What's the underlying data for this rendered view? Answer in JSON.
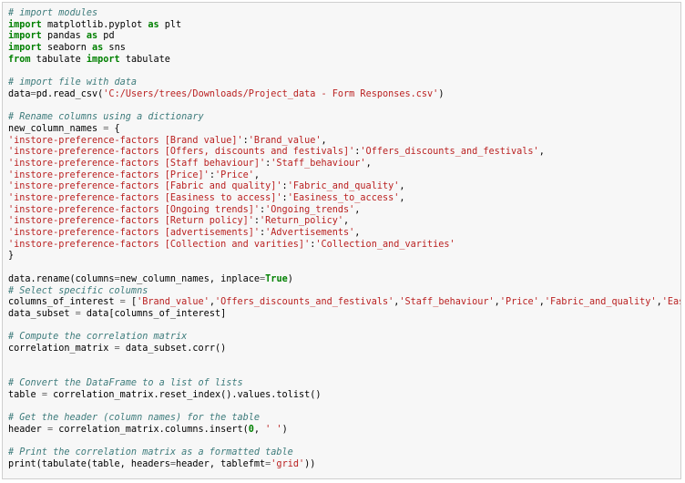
{
  "editor": {
    "lines": [
      [
        [
          "cm",
          "# import modules"
        ]
      ],
      [
        [
          "kw",
          "import"
        ],
        [
          "nm",
          " matplotlib.pyplot "
        ],
        [
          "kw",
          "as"
        ],
        [
          "nm",
          " plt"
        ]
      ],
      [
        [
          "kw",
          "import"
        ],
        [
          "nm",
          " pandas "
        ],
        [
          "kw",
          "as"
        ],
        [
          "nm",
          " pd"
        ]
      ],
      [
        [
          "kw",
          "import"
        ],
        [
          "nm",
          " seaborn "
        ],
        [
          "kw",
          "as"
        ],
        [
          "nm",
          " sns"
        ]
      ],
      [
        [
          "kw",
          "from"
        ],
        [
          "nm",
          " tabulate "
        ],
        [
          "kw",
          "import"
        ],
        [
          "nm",
          " tabulate"
        ]
      ],
      [],
      [
        [
          "cm",
          "# import file with data"
        ]
      ],
      [
        [
          "nm",
          "data"
        ],
        [
          "op",
          "="
        ],
        [
          "nm",
          "pd.read_csv("
        ],
        [
          "st",
          "'C:/Users/trees/Downloads/Project_data - Form Responses.csv'"
        ],
        [
          "nm",
          ")"
        ]
      ],
      [],
      [
        [
          "cm",
          "# Rename columns using a dictionary"
        ]
      ],
      [
        [
          "nm",
          "new_column_names "
        ],
        [
          "op",
          "="
        ],
        [
          "nm",
          " {"
        ]
      ],
      [
        [
          "st",
          "'instore-preference-factors [Brand value]'"
        ],
        [
          "nm",
          ":"
        ],
        [
          "st",
          "'Brand_value'"
        ],
        [
          "nm",
          ","
        ]
      ],
      [
        [
          "st",
          "'instore-preference-factors [Offers, discounts and festivals]'"
        ],
        [
          "nm",
          ":"
        ],
        [
          "st",
          "'Offers_discounts_and_festivals'"
        ],
        [
          "nm",
          ","
        ]
      ],
      [
        [
          "st",
          "'instore-preference-factors [Staff behaviour]'"
        ],
        [
          "nm",
          ":"
        ],
        [
          "st",
          "'Staff_behaviour'"
        ],
        [
          "nm",
          ","
        ]
      ],
      [
        [
          "st",
          "'instore-preference-factors [Price]'"
        ],
        [
          "nm",
          ":"
        ],
        [
          "st",
          "'Price'"
        ],
        [
          "nm",
          ","
        ]
      ],
      [
        [
          "st",
          "'instore-preference-factors [Fabric and quality]'"
        ],
        [
          "nm",
          ":"
        ],
        [
          "st",
          "'Fabric_and_quality'"
        ],
        [
          "nm",
          ","
        ]
      ],
      [
        [
          "st",
          "'instore-preference-factors [Easiness to access]'"
        ],
        [
          "nm",
          ":"
        ],
        [
          "st",
          "'Easiness_to_access'"
        ],
        [
          "nm",
          ","
        ]
      ],
      [
        [
          "st",
          "'instore-preference-factors [Ongoing trends]'"
        ],
        [
          "nm",
          ":"
        ],
        [
          "st",
          "'Ongoing_trends'"
        ],
        [
          "nm",
          ","
        ]
      ],
      [
        [
          "st",
          "'instore-preference-factors [Return policy]'"
        ],
        [
          "nm",
          ":"
        ],
        [
          "st",
          "'Return_policy'"
        ],
        [
          "nm",
          ","
        ]
      ],
      [
        [
          "st",
          "'instore-preference-factors [advertisements]'"
        ],
        [
          "nm",
          ":"
        ],
        [
          "st",
          "'Advertisements'"
        ],
        [
          "nm",
          ","
        ]
      ],
      [
        [
          "st",
          "'instore-preference-factors [Collection and varities]'"
        ],
        [
          "nm",
          ":"
        ],
        [
          "st",
          "'Collection_and_varities'"
        ]
      ],
      [
        [
          "nm",
          "}"
        ]
      ],
      [],
      [
        [
          "nm",
          "data.rename(columns"
        ],
        [
          "op",
          "="
        ],
        [
          "nm",
          "new_column_names, inplace"
        ],
        [
          "op",
          "="
        ],
        [
          "cn",
          "True"
        ],
        [
          "nm",
          ")"
        ]
      ],
      [
        [
          "cm",
          "# Select specific columns"
        ]
      ],
      [
        [
          "nm",
          "columns_of_interest "
        ],
        [
          "op",
          "="
        ],
        [
          "nm",
          " ["
        ],
        [
          "st",
          "'Brand_value'"
        ],
        [
          "nm",
          ","
        ],
        [
          "st",
          "'Offers_discounts_and_festivals'"
        ],
        [
          "nm",
          ","
        ],
        [
          "st",
          "'Staff_behaviour'"
        ],
        [
          "nm",
          ","
        ],
        [
          "st",
          "'Price'"
        ],
        [
          "nm",
          ","
        ],
        [
          "st",
          "'Fabric_and_quality'"
        ],
        [
          "nm",
          ","
        ],
        [
          "st",
          "'Easiness_to"
        ]
      ],
      [
        [
          "nm",
          "data_subset "
        ],
        [
          "op",
          "="
        ],
        [
          "nm",
          " data[columns_of_interest]"
        ]
      ],
      [],
      [
        [
          "cm",
          "# Compute the correlation matrix"
        ]
      ],
      [
        [
          "nm",
          "correlation_matrix "
        ],
        [
          "op",
          "="
        ],
        [
          "nm",
          " data_subset.corr()"
        ]
      ],
      [],
      [],
      [
        [
          "cm",
          "# Convert the DataFrame to a list of lists"
        ]
      ],
      [
        [
          "nm",
          "table "
        ],
        [
          "op",
          "="
        ],
        [
          "nm",
          " correlation_matrix.reset_index().values.tolist()"
        ]
      ],
      [],
      [
        [
          "cm",
          "# Get the header (column names) for the table"
        ]
      ],
      [
        [
          "nm",
          "header "
        ],
        [
          "op",
          "="
        ],
        [
          "nm",
          " correlation_matrix.columns.insert("
        ],
        [
          "cn",
          "0"
        ],
        [
          "nm",
          ", "
        ],
        [
          "st",
          "' '"
        ],
        [
          "nm",
          ")"
        ]
      ],
      [],
      [
        [
          "cm",
          "# Print the correlation matrix as a formatted table"
        ]
      ],
      [
        [
          "nm",
          "print(tabulate(table, headers"
        ],
        [
          "op",
          "="
        ],
        [
          "nm",
          "header, tablefmt"
        ],
        [
          "op",
          "="
        ],
        [
          "st",
          "'grid'"
        ],
        [
          "nm",
          "))"
        ]
      ]
    ]
  }
}
